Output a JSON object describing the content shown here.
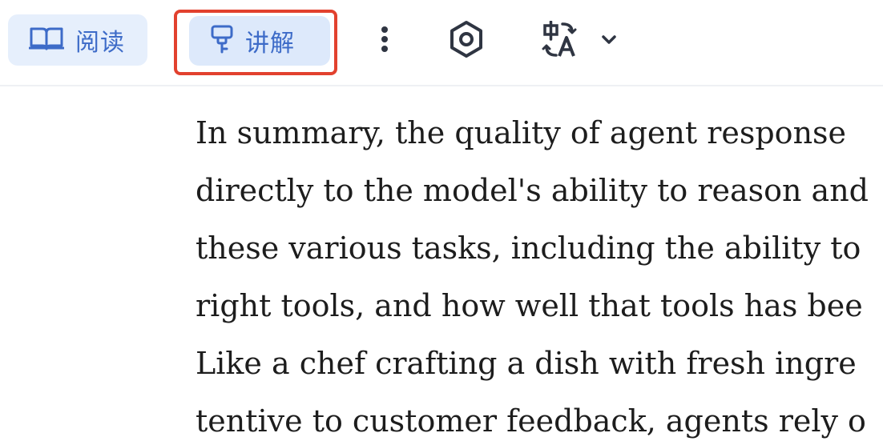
{
  "toolbar": {
    "read_label": "阅读",
    "explain_label": "讲解",
    "icons": {
      "read": "open-book-icon",
      "explain": "presentation-lamp-icon",
      "more": "more-vertical-icon",
      "settings": "hexagon-settings-icon",
      "translate": "translate-icon",
      "dropdown": "chevron-down-icon"
    }
  },
  "content": {
    "lines": [
      "In summary, the quality of agent response",
      "directly to the model's ability to reason and",
      "these various tasks, including the ability to",
      "right tools, and how well that tools has bee",
      "Like a chef crafting a dish with fresh ingre",
      "tentive to customer feedback, agents rely o"
    ]
  },
  "colors": {
    "accent": "#3d6bc8",
    "button_bg": "#e6effc",
    "highlight_border": "#e2412e",
    "icon_dark": "#2f3542"
  }
}
